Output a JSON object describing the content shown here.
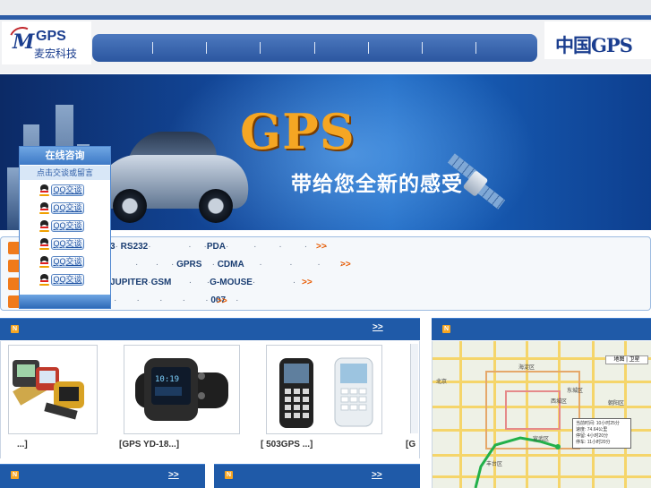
{
  "header": {
    "logo_gps": "GPS",
    "logo_company": "麦宏科技",
    "brand_right": "中国GPS",
    "nav_items": [
      "",
      "",
      "",
      "",
      "",
      "",
      "",
      ""
    ]
  },
  "banner": {
    "title": "GPS",
    "slogan": "带给您全新的感受"
  },
  "online_panel": {
    "title": "在线咨询",
    "subtitle": "点击交谈或留言",
    "qq_buttons": [
      "QQ交谈",
      "QQ交谈",
      "QQ交谈",
      "QQ交谈",
      "QQ交谈",
      "QQ交谈"
    ]
  },
  "info_lines": [
    {
      "parts": [
        "3",
        "RS232",
        "PDA"
      ],
      "more": ">>"
    },
    {
      "parts": [
        "GPRS",
        "CDMA"
      ],
      "more": ">>"
    },
    {
      "parts": [
        "JUPITER",
        "GSM",
        "G-MOUSE"
      ],
      "more": ">>"
    },
    {
      "parts": [
        "007"
      ],
      "more": ">>"
    }
  ],
  "sections": {
    "products_more": ">>",
    "map_icon": "N",
    "bottom_left_more": ">>",
    "bottom_mid_more": ">>"
  },
  "products": [
    {
      "caption": "...]"
    },
    {
      "caption": "[GPS      YD-18...]"
    },
    {
      "caption": "[      503GPS    ...]"
    },
    {
      "caption": "[G"
    }
  ],
  "map": {
    "control_label": "地图 | 卫星",
    "info_lines": [
      "当前时间: 10小时25分",
      "速度: 74.64公里",
      "停留: 4小时20分",
      "停车: 11小时20分"
    ],
    "labels": [
      "海淀区",
      "西城区",
      "东城区",
      "朝阳区",
      "丰台区",
      "宣武区",
      "北京"
    ]
  },
  "colors": {
    "accent_blue": "#1f5aa8",
    "more_orange": "#e85a00",
    "banner_gold": "#f5a623"
  }
}
